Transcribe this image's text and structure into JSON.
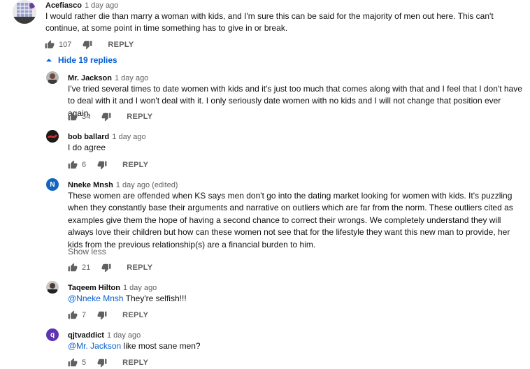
{
  "top_comment": {
    "author": "Acefiasco",
    "time": "1 day ago",
    "text": "I would rather die than marry a woman with kids, and I'm sure this can be said for the majority of men out here. This can't continue, at some point in time something has to give in or break.",
    "likes": "107",
    "reply_label": "REPLY"
  },
  "replies_toggle": {
    "label": "Hide 19 replies"
  },
  "replies": [
    {
      "author": "Mr. Jackson",
      "time": "1 day ago",
      "text": "I've tried several times to date women with kids and it's just too much that comes along with that and I feel that I don't have to deal with it and I won't deal with it. I only seriously date women with no kids and I will not change that position ever again.",
      "likes": "34",
      "reply_label": "REPLY"
    },
    {
      "author": "bob ballard",
      "time": "1 day ago",
      "text": "I do agree",
      "likes": "6",
      "reply_label": "REPLY"
    },
    {
      "author": "Nneke Mnsh",
      "avatar_letter": "N",
      "time": "1 day ago (edited)",
      "text": "These women are offended when KS says men don't go into the dating market looking for women with kids. It's puzzling when they constantly base their arguments and narrative on outliers which are far from the norm. These outliers cited as examples give them the hope of having a second chance to correct their wrongs. We completely understand they will always love their children but how can these women not see that for the lifestyle they want this new man to provide, her kids from the previous relationship(s) are a financial burden to him.",
      "show_less": "Show less",
      "likes": "21",
      "reply_label": "REPLY"
    },
    {
      "author": "Taqeem Hilton",
      "time": "1 day ago",
      "mention": "@Nneke Mnsh",
      "text": " They're selfish!!!",
      "likes": "7",
      "reply_label": "REPLY"
    },
    {
      "author": "qjtvaddict",
      "avatar_letter": "q",
      "time": "1 day ago",
      "mention": "@Mr. Jackson",
      "text": " like most sane men?",
      "likes": "5",
      "reply_label": "REPLY"
    }
  ],
  "colors": {
    "link": "#065fd4",
    "secondary_text": "#606060",
    "avatar_nneke": "#1565c0",
    "avatar_qjtv": "#5e35b1"
  }
}
